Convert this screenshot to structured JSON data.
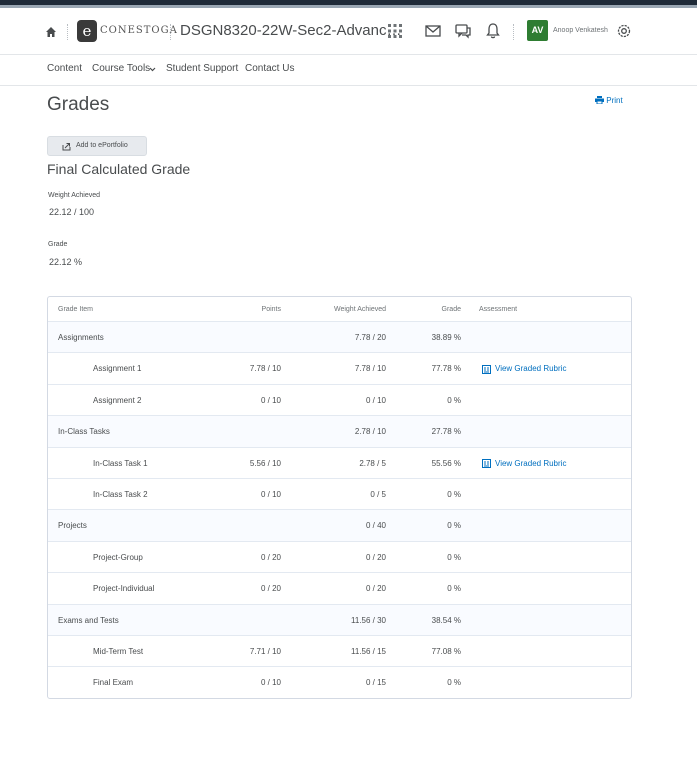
{
  "header": {
    "logo_letter": "e",
    "logo_text": "CONESTOGA",
    "course_title": "DSGN8320-22W-Sec2-Advanc…",
    "avatar_initials": "AV",
    "user_name": "Anoop Venkatesh",
    "icons": [
      "home-icon",
      "apps-grid-icon",
      "mail-icon",
      "chat-icon",
      "bell-icon",
      "gear-icon"
    ]
  },
  "nav": {
    "items": [
      "Content",
      "Course Tools",
      "Student Support",
      "Contact Us"
    ]
  },
  "page": {
    "title": "Grades",
    "print_label": "Print",
    "eportfolio_label": "Add to ePortfolio",
    "final_title": "Final Calculated Grade",
    "weight_label": "Weight Achieved",
    "weight_value": "22.12 / 100",
    "grade_label": "Grade",
    "grade_value": "22.12 %"
  },
  "table": {
    "headers": [
      "Grade Item",
      "Points",
      "Weight Achieved",
      "Grade",
      "Assessment"
    ],
    "rows": [
      {
        "kind": "cat",
        "item": "Assignments",
        "points": "",
        "weight": "7.78 / 20",
        "grade": "38.89 %",
        "assessment": ""
      },
      {
        "kind": "item",
        "item": "Assignment 1",
        "points": "7.78 / 10",
        "weight": "7.78 / 10",
        "grade": "77.78 %",
        "assessment": "View Graded Rubric"
      },
      {
        "kind": "item",
        "item": "Assignment 2",
        "points": "0 / 10",
        "weight": "0 / 10",
        "grade": "0 %",
        "assessment": ""
      },
      {
        "kind": "cat",
        "item": "In-Class Tasks",
        "points": "",
        "weight": "2.78 / 10",
        "grade": "27.78 %",
        "assessment": ""
      },
      {
        "kind": "item",
        "item": "In-Class Task 1",
        "points": "5.56 / 10",
        "weight": "2.78 / 5",
        "grade": "55.56 %",
        "assessment": "View Graded Rubric"
      },
      {
        "kind": "item",
        "item": "In-Class Task 2",
        "points": "0 / 10",
        "weight": "0 / 5",
        "grade": "0 %",
        "assessment": ""
      },
      {
        "kind": "cat",
        "item": "Projects",
        "points": "",
        "weight": "0 / 40",
        "grade": "0 %",
        "assessment": ""
      },
      {
        "kind": "item",
        "item": "Project-Group",
        "points": "0 / 20",
        "weight": "0 / 20",
        "grade": "0 %",
        "assessment": ""
      },
      {
        "kind": "item",
        "item": "Project-Individual",
        "points": "0 / 20",
        "weight": "0 / 20",
        "grade": "0 %",
        "assessment": ""
      },
      {
        "kind": "cat",
        "item": "Exams and Tests",
        "points": "",
        "weight": "11.56 / 30",
        "grade": "38.54 %",
        "assessment": ""
      },
      {
        "kind": "item",
        "item": "Mid-Term Test",
        "points": "7.71 / 10",
        "weight": "11.56 / 15",
        "grade": "77.08 %",
        "assessment": ""
      },
      {
        "kind": "item",
        "item": "Final Exam",
        "points": "0 / 10",
        "weight": "0 / 15",
        "grade": "0 %",
        "assessment": ""
      }
    ]
  },
  "colors": {
    "link": "#006fbf",
    "avatar": "#2e7d32",
    "category_row": "#f9fbff"
  }
}
